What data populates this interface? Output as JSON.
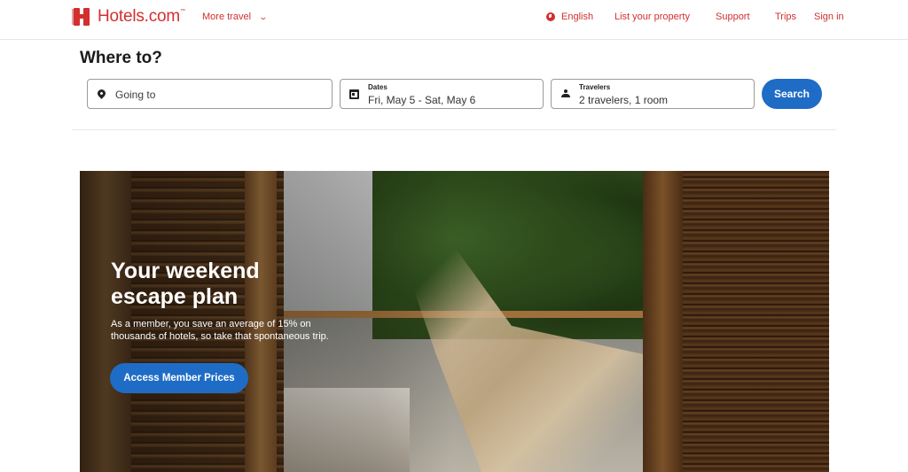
{
  "header": {
    "brand": "Hotels.com",
    "brand_tm": "™",
    "more_travel": "More travel",
    "nav": {
      "language": "English",
      "list_property": "List your property",
      "support": "Support",
      "trips": "Trips",
      "sign_in": "Sign in"
    }
  },
  "search": {
    "heading": "Where to?",
    "destination_placeholder": "Going to",
    "dates_label": "Dates",
    "dates_value": "Fri, May 5 - Sat, May 6",
    "travelers_label": "Travelers",
    "travelers_value": "2 travelers, 1 room",
    "search_button": "Search"
  },
  "hero": {
    "title": "Your weekend escape plan",
    "body": "As a member, you save an average of 15% on thousands of hotels, so take that spontaneous trip.",
    "cta": "Access Member Prices"
  },
  "colors": {
    "brand": "#d32f2f",
    "primary_button": "#1f6cc6"
  }
}
